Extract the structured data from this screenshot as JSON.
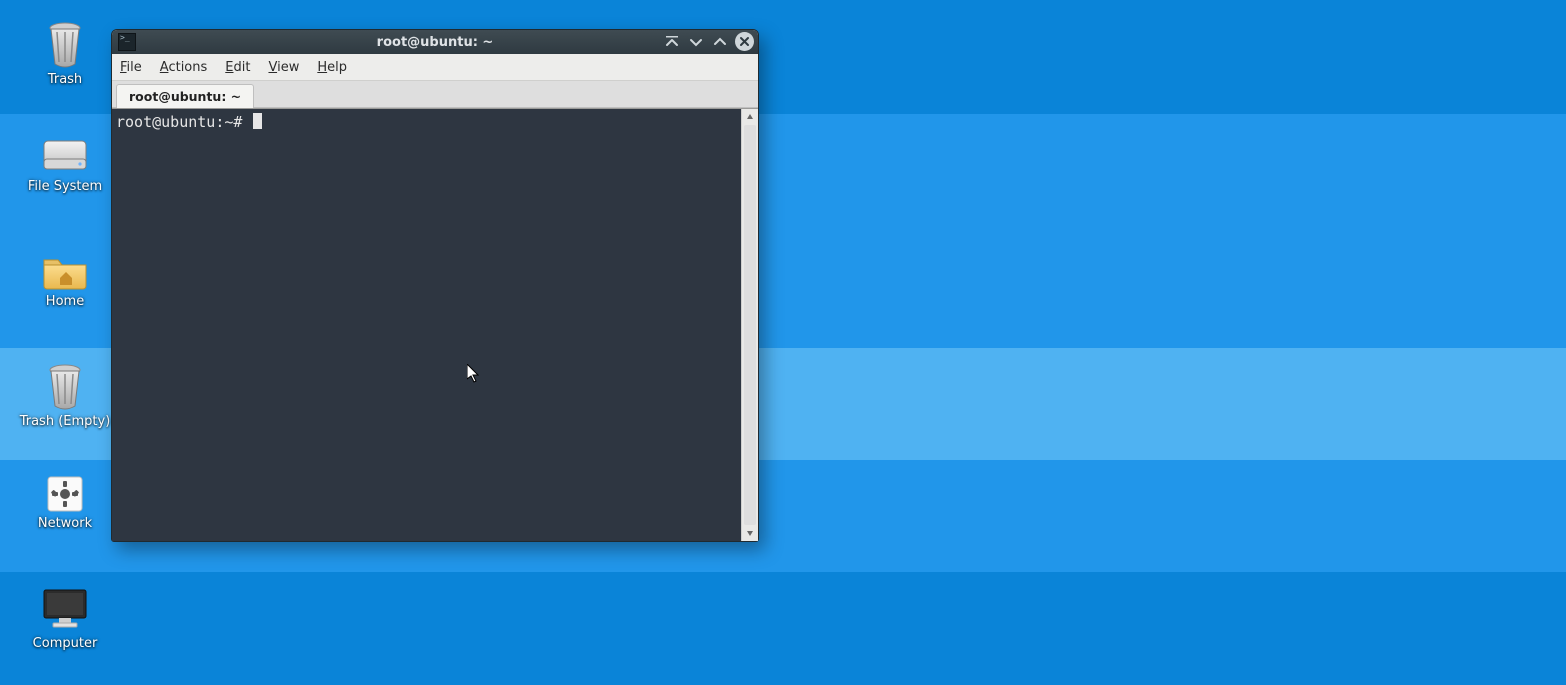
{
  "desktop": {
    "icons": [
      {
        "name": "trash",
        "label": "Trash",
        "kind": "trash"
      },
      {
        "name": "file-system",
        "label": "File System",
        "kind": "drive"
      },
      {
        "name": "home",
        "label": "Home",
        "kind": "folder"
      },
      {
        "name": "trash-empty",
        "label": "Trash (Empty)",
        "kind": "trash"
      },
      {
        "name": "network",
        "label": "Network",
        "kind": "settings"
      },
      {
        "name": "computer",
        "label": "Computer",
        "kind": "monitor"
      }
    ]
  },
  "window": {
    "title": "root@ubuntu: ~",
    "menu": [
      "File",
      "Actions",
      "Edit",
      "View",
      "Help"
    ],
    "tab": "root@ubuntu: ~",
    "prompt": "root@ubuntu:~# "
  }
}
